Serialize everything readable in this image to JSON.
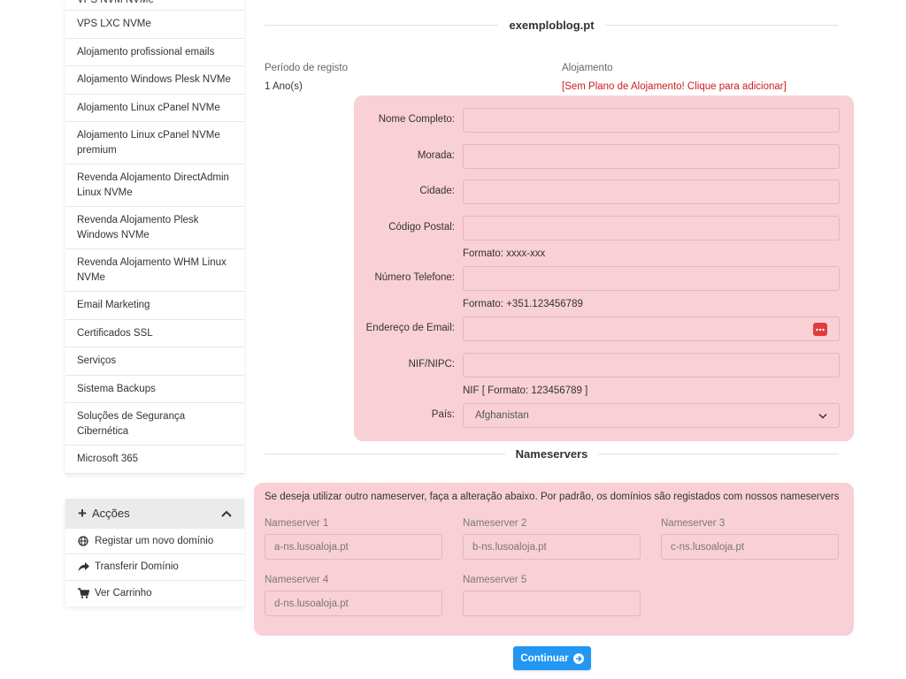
{
  "sidebar": {
    "items": [
      {
        "label": "VPS NVM NVMe"
      },
      {
        "label": "VPS LXC NVMe"
      },
      {
        "label": "Alojamento profissional emails"
      },
      {
        "label": "Alojamento Windows Plesk NVMe"
      },
      {
        "label": "Alojamento Linux cPanel NVMe"
      },
      {
        "label": "Alojamento Linux cPanel NVMe premium"
      },
      {
        "label": "Revenda Alojamento DirectAdmin Linux NVMe"
      },
      {
        "label": "Revenda Alojamento Plesk Windows NVMe"
      },
      {
        "label": "Revenda Alojamento WHM Linux NVMe"
      },
      {
        "label": "Email Marketing"
      },
      {
        "label": "Certificados SSL"
      },
      {
        "label": "Serviços"
      },
      {
        "label": "Sistema Backups"
      },
      {
        "label": "Soluções de Segurança Cibernética"
      },
      {
        "label": "Microsoft 365"
      }
    ]
  },
  "actions": {
    "title": "Acções",
    "items": [
      {
        "label": "Registar um novo domínio",
        "icon": "globe-icon"
      },
      {
        "label": "Transferir Domínio",
        "icon": "share-arrow-icon"
      },
      {
        "label": "Ver Carrinho",
        "icon": "cart-icon"
      }
    ]
  },
  "domain": {
    "title": "exemploblog.pt",
    "period_label": "Período de registo",
    "period_value": "1 Ano(s)",
    "hosting_label": "Alojamento",
    "hosting_value": "[Sem Plano de Alojamento! Clique para adicionar]"
  },
  "form": {
    "full_name_label": "Nome Completo:",
    "address_label": "Morada:",
    "city_label": "Cidade:",
    "postcode_label": "Código Postal:",
    "postcode_help": "Formato: xxxx-xxx",
    "phone_label": "Número Telefone:",
    "phone_help": "Formato: +351.123456789",
    "email_label": "Endereço de Email:",
    "nif_label": "NIF/NIPC:",
    "nif_help": "NIF [ Formato: 123456789 ]",
    "country_label": "País:",
    "country_value": "Afghanistan"
  },
  "nameservers": {
    "title": "Nameservers",
    "description": "Se deseja utilizar outro nameserver, faça a alteração abaixo. Por padrão, os domínios são registados com nossos nameservers",
    "items": [
      {
        "label": "Nameserver 1",
        "value": "a-ns.lusoaloja.pt"
      },
      {
        "label": "Nameserver 2",
        "value": "b-ns.lusoaloja.pt"
      },
      {
        "label": "Nameserver 3",
        "value": "c-ns.lusoaloja.pt"
      },
      {
        "label": "Nameserver 4",
        "value": "d-ns.lusoaloja.pt"
      },
      {
        "label": "Nameserver 5",
        "value": ""
      }
    ]
  },
  "continue_label": "Continuar",
  "colors": {
    "accent": "#2196f3",
    "warning_text": "#cc1d1d",
    "highlight_bg": "#f9d0d6"
  }
}
